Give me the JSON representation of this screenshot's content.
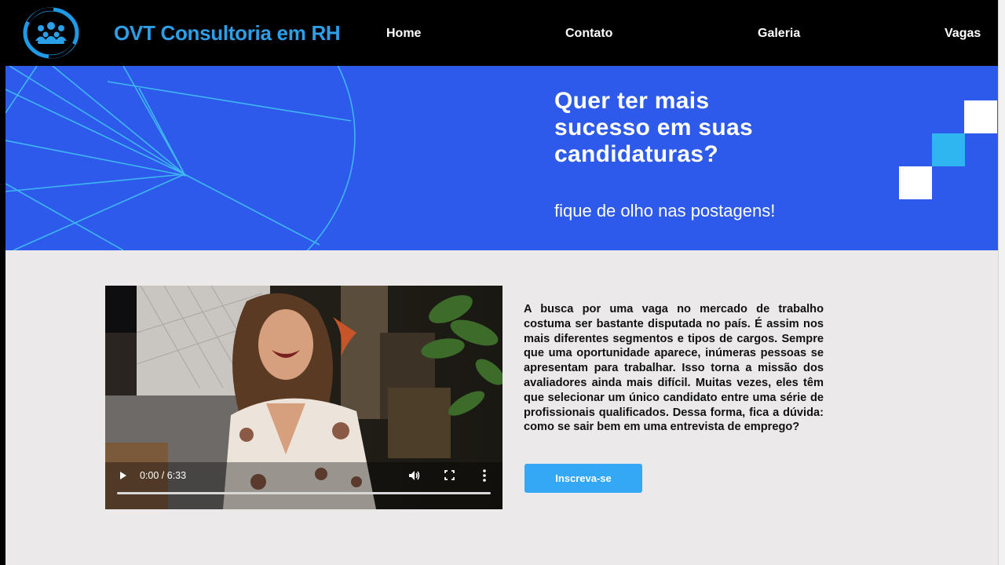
{
  "header": {
    "logo_icon": "people-circle-logo-icon",
    "brand": "OVT Consultoria em RH",
    "nav": [
      {
        "label": "Home"
      },
      {
        "label": "Contato"
      },
      {
        "label": "Galeria"
      },
      {
        "label": "Vagas"
      }
    ]
  },
  "banner": {
    "headline": "Quer ter mais\nsucesso em suas\ncandidaturas?",
    "subline": "fique de olho nas postagens!"
  },
  "video": {
    "time": "0:00 / 6:33",
    "progress": 0,
    "icons": [
      "play-icon",
      "volume-icon",
      "fullscreen-icon",
      "more-options-icon"
    ]
  },
  "article": {
    "text": "A busca por uma vaga no mercado de trabalho costuma ser bastante disputada no país. É assim nos mais diferentes segmentos e tipos de cargos. Sempre que uma oportunidade aparece, inúmeras pessoas se apresentam para trabalhar. Isso torna a missão dos avaliadores ainda mais difícil. Muitas vezes, eles têm que selecionar um único candidato entre uma série de profissionais qualificados. Dessa forma, fica a dúvida: como se sair bem em uma entrevista de emprego?",
    "button_label": "Inscreva-se"
  },
  "colors": {
    "header_bg": "#000000",
    "brand": "#2e9ee6",
    "banner_bg": "#2d5aea",
    "main_bg": "#ebe9ea",
    "button": "#34a7f5"
  }
}
